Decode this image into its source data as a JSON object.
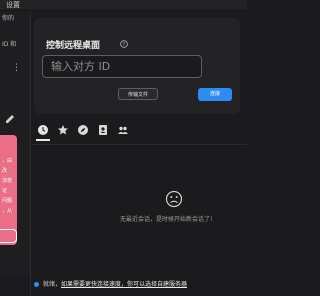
{
  "window": {
    "title": "设置"
  },
  "sidebar": {
    "fragments": [
      "你的",
      "ID 和",
      "密码",
      "复制",
      "一次",
      "这一",
      "以后"
    ],
    "card_fragments": [
      "，由",
      "改",
      "法校",
      "证",
      "问题",
      "，从"
    ]
  },
  "remote": {
    "title": "控制远程桌面",
    "id_placeholder": "输入对方 ID",
    "transfer_label": "传输文件",
    "connect_label": "连接"
  },
  "tabs": [
    {
      "name": "recent",
      "icon": "clock-icon",
      "active": true
    },
    {
      "name": "favorites",
      "icon": "star-icon"
    },
    {
      "name": "discovered",
      "icon": "compass-icon"
    },
    {
      "name": "address-book",
      "icon": "contact-book-icon"
    },
    {
      "name": "group",
      "icon": "group-icon"
    }
  ],
  "empty_state": {
    "icon": "sad-face-icon",
    "text": "无最近会话，是时候开始新会话了!"
  },
  "status": {
    "prefix": "就绪，",
    "link": "如果需要更快连接速度，你可以选择自建服务器"
  },
  "colors": {
    "accent": "#2c8cf4",
    "warning_card": "#ea6f86",
    "background": "#1b1b1d"
  }
}
